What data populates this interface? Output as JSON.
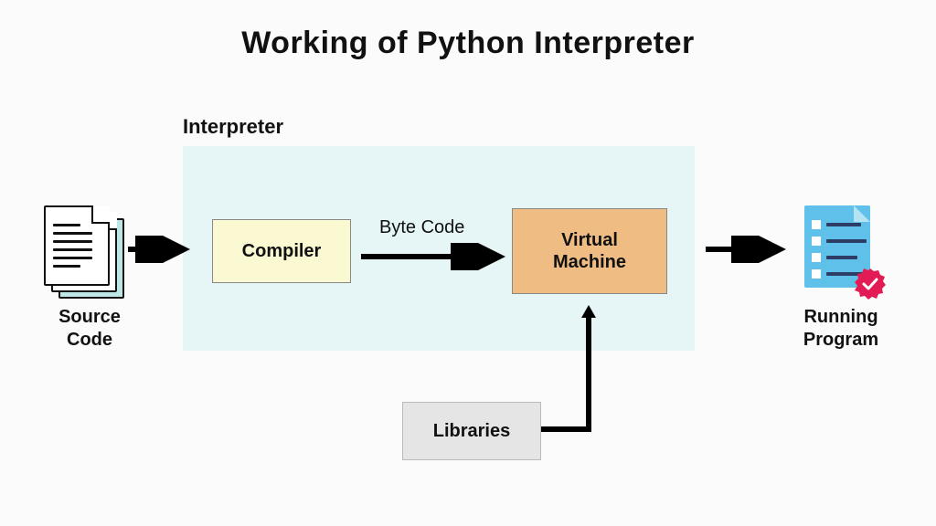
{
  "title": "Working of Python Interpreter",
  "interpreter_label": "Interpreter",
  "blocks": {
    "compiler": "Compiler",
    "vm_line1": "Virtual",
    "vm_line2": "Machine",
    "libraries": "Libraries"
  },
  "labels": {
    "bytecode": "Byte Code",
    "source_line1": "Source",
    "source_line2": "Code",
    "running_line1": "Running",
    "running_line2": "Program"
  },
  "colors": {
    "interpreter_bg": "#e6f5f6",
    "compiler_bg": "#faf9d2",
    "vm_bg": "#efbc84",
    "libraries_bg": "#e5e5e5",
    "seal": "#e31b54",
    "sheet": "#5fc1ea"
  }
}
